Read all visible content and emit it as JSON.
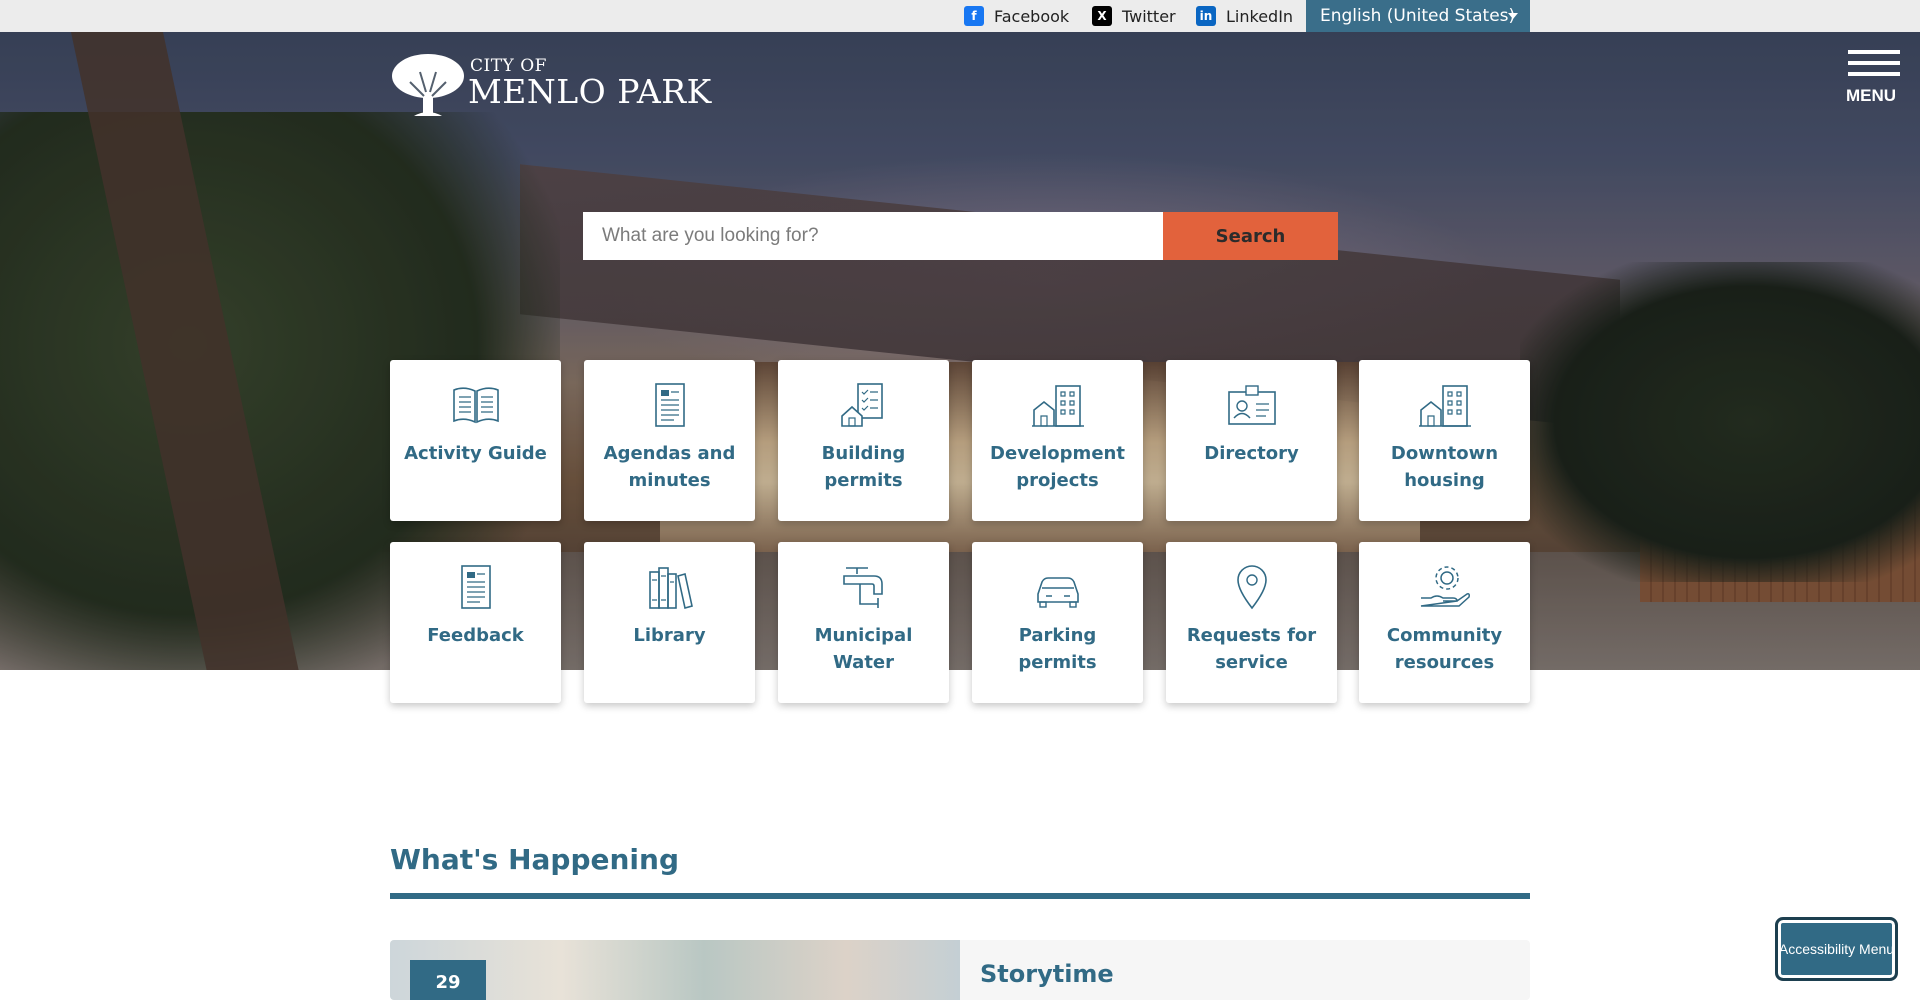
{
  "topbar": {
    "social": [
      {
        "label": "Facebook",
        "icon": "facebook-icon",
        "color": "#1877f2"
      },
      {
        "label": "Twitter",
        "icon": "x-twitter-icon",
        "color": "#000000"
      },
      {
        "label": "LinkedIn",
        "icon": "linkedin-icon",
        "color": "#0a66c2"
      }
    ],
    "language": "English (United States)"
  },
  "header": {
    "logo_city": "CITY OF",
    "logo_name": "MENLO PARK",
    "menu_label": "MENU"
  },
  "search": {
    "placeholder": "What are you looking for?",
    "button": "Search"
  },
  "quick_links": [
    {
      "label": "Activity Guide",
      "icon": "open-book-icon"
    },
    {
      "label": "Agendas and minutes",
      "icon": "document-icon"
    },
    {
      "label": "Building permits",
      "icon": "house-checklist-icon"
    },
    {
      "label": "Development projects",
      "icon": "buildings-icon"
    },
    {
      "label": "Directory",
      "icon": "id-card-icon"
    },
    {
      "label": "Downtown housing",
      "icon": "housing-icon"
    },
    {
      "label": "Feedback",
      "icon": "feedback-document-icon"
    },
    {
      "label": "Library",
      "icon": "books-icon"
    },
    {
      "label": "Municipal Water",
      "icon": "faucet-icon"
    },
    {
      "label": "Parking permits",
      "icon": "car-icon"
    },
    {
      "label": "Requests for service",
      "icon": "map-pin-icon"
    },
    {
      "label": "Community resources",
      "icon": "hand-gear-icon"
    }
  ],
  "whats_happening": {
    "title": "What's Happening",
    "events": [
      {
        "date": "29",
        "title": "Storytime"
      }
    ]
  },
  "accessibility_menu": "Accessibility Menu",
  "colors": {
    "brand_blue": "#316a85",
    "search_button": "#e2623c",
    "language_bar": "#3a6e8a"
  }
}
